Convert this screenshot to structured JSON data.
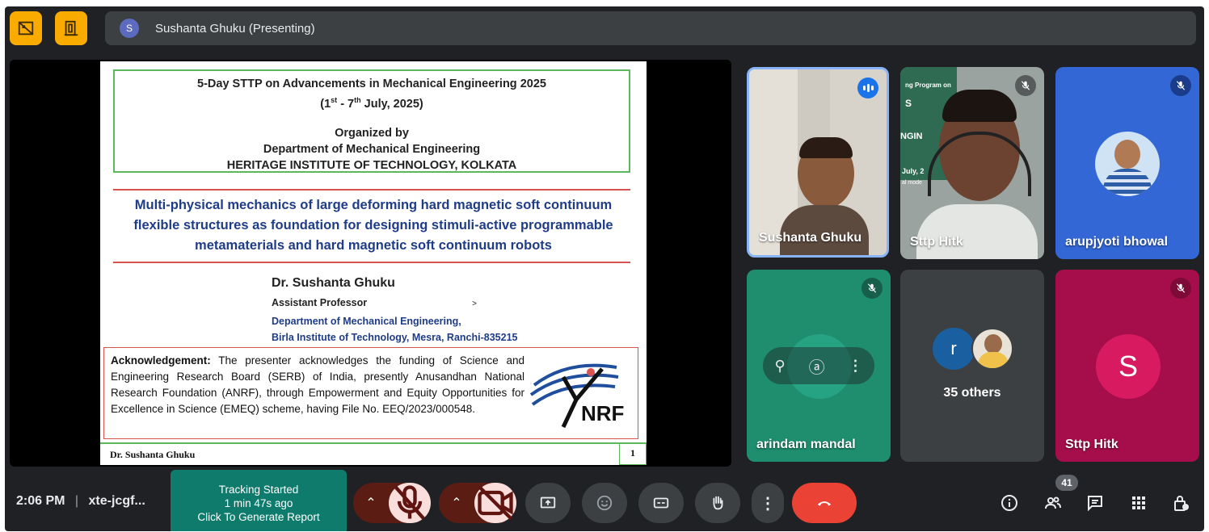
{
  "top_bar": {
    "presenter_initial": "S",
    "presenting_label": "Sushanta Ghuku (Presenting)"
  },
  "slide": {
    "header_line1": "5-Day STTP on Advancements in Mechanical Engineering 2025",
    "header_line2_pre": "(1",
    "header_line2_sup1": "st",
    "header_line2_mid": " - 7",
    "header_line2_sup2": "th",
    "header_line2_post": " July, 2025)",
    "organized_by": "Organized by",
    "department": "Department of Mechanical Engineering",
    "institute": "HERITAGE INSTITUTE OF TECHNOLOGY, KOLKATA",
    "title_line1": "Multi-physical mechanics of large deforming hard magnetic soft continuum",
    "title_line2": "flexible structures as foundation for designing stimuli-active programmable",
    "title_line3": "metamaterials and hard magnetic soft continuum robots",
    "author": "Dr. Sushanta Ghuku",
    "role": "Assistant Professor",
    "role_mark": ">",
    "dept_line1": "Department of Mechanical Engineering,",
    "dept_line2": "Birla Institute of Technology, Mesra, Ranchi-835215",
    "ack_heading": "Acknowledgement:",
    "ack_body": " The presenter acknowledges the funding of Science and Engineering Research Board (SERB) of India, presently Anusandhan National Research Foundation (ANRF), through Empowerment and Equity Opportunities for Excellence in Science (EMEQ) scheme, having File No. EEQ/2023/000548.",
    "logo_text": "NRF",
    "footer_name": "Dr. Sushanta Ghuku",
    "page_number": "1"
  },
  "tiles": {
    "t1": "Sushanta Ghuku",
    "t2": "Sttp Hitk",
    "t2_bg_text1": "ng Program on",
    "t2_bg_text2": "S",
    "t2_bg_text3": "NGIN",
    "t2_bg_text4": "July, 2",
    "t2_bg_text5": "al mode",
    "t3": "arupjyoti bhowal",
    "t4": "arindam mandal",
    "t5_avatar": "r",
    "t5_label": "35 others",
    "t6": "Sttp Hitk",
    "t6_avatar": "S"
  },
  "bottom_bar": {
    "time": "2:06 PM",
    "separator": "|",
    "meeting_code": "xte-jcgf...",
    "tracking_line1": "Tracking Started",
    "tracking_line2": "1 min 47s ago",
    "tracking_line3": "Click To Generate Report",
    "people_count": "41"
  },
  "colors": {
    "background": "#202124",
    "accent_yellow": "#f9ab00",
    "end_call": "#ea4335",
    "tracking_green": "#0f7b6c"
  }
}
